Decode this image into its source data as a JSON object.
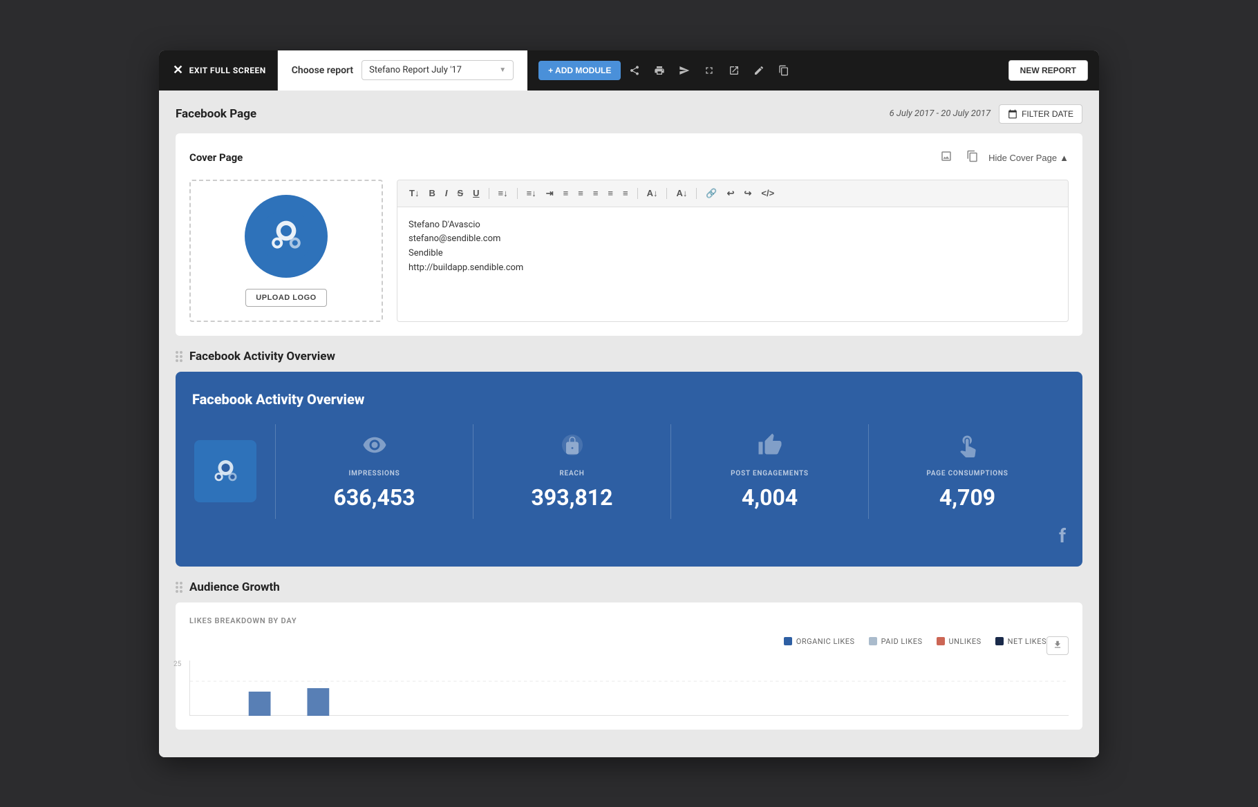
{
  "topNav": {
    "exitLabel": "EXIT FULL SCREEN",
    "chooseReportLabel": "Choose report",
    "selectedReport": "Stefano Report July '17",
    "addModuleLabel": "+ ADD MODULE",
    "newReportLabel": "NEW REPORT"
  },
  "header": {
    "pageTitle": "Facebook Page",
    "dateRange": "6 July 2017 - 20 July 2017",
    "filterDateLabel": "FILTER DATE"
  },
  "coverPage": {
    "title": "Cover Page",
    "uploadLogoLabel": "UPLOAD LOGO",
    "hideCoverLabel": "Hide Cover Page",
    "editorContent": {
      "line1": "Stefano D'Avascio",
      "line2": "stefano@sendible.com",
      "line3": "Sendible",
      "line4": "http://buildapp.sendible.com"
    }
  },
  "facebookOverview": {
    "sectionTitle": "Facebook Activity Overview",
    "cardTitle": "Facebook Activity Overview",
    "stats": [
      {
        "label": "IMPRESSIONS",
        "value": "636,453",
        "icon": "👁"
      },
      {
        "label": "REACH",
        "value": "393,812",
        "icon": "📢"
      },
      {
        "label": "POST ENGAGEMENTS",
        "value": "4,004",
        "icon": "👍"
      },
      {
        "label": "PAGE CONSUMPTIONS",
        "value": "4,709",
        "icon": "👆"
      }
    ]
  },
  "audienceGrowth": {
    "sectionTitle": "Audience Growth",
    "subtitle": "LIKES BREAKDOWN BY DAY",
    "legend": [
      {
        "label": "ORGANIC LIKES",
        "color": "#2e5fa3"
      },
      {
        "label": "PAID LIKES",
        "color": "#aabbcc"
      },
      {
        "label": "UNLIKES",
        "color": "#cc6655"
      },
      {
        "label": "NET LIKES",
        "color": "#1a2a4a"
      }
    ],
    "yAxisValue": "25"
  },
  "colors": {
    "accent": "#2e5fa3",
    "darkBlue": "#1a2a4a",
    "lightBlue": "#aabbcc",
    "red": "#cc6655"
  }
}
